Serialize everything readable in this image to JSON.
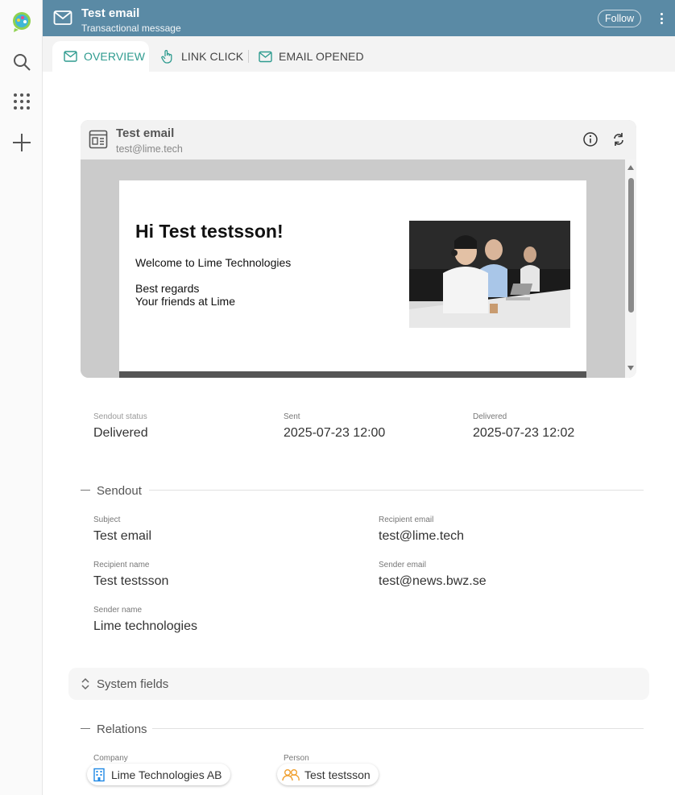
{
  "header": {
    "title": "Test email",
    "subtitle": "Transactional message",
    "follow_label": "Follow"
  },
  "tabs": [
    {
      "label": "OVERVIEW",
      "icon": "envelope-icon",
      "active": true
    },
    {
      "label": "LINK CLICK",
      "icon": "pointer-hand-icon",
      "active": false
    },
    {
      "label": "EMAIL OPENED",
      "icon": "envelope-open-icon",
      "active": false
    }
  ],
  "email_card": {
    "title": "Test email",
    "address": "test@lime.tech",
    "preview": {
      "heading": "Hi Test testsson!",
      "welcome": "Welcome to Lime Technologies",
      "regards": "Best regards",
      "signature": "Your friends at Lime"
    }
  },
  "status": {
    "sendout_status_label": "Sendout status",
    "sendout_status": "Delivered",
    "sent_label": "Sent",
    "sent": "2025-07-23 12:00",
    "delivered_label": "Delivered",
    "delivered": "2025-07-23 12:02"
  },
  "sendout": {
    "title": "Sendout",
    "subject_label": "Subject",
    "subject": "Test email",
    "recipient_email_label": "Recipient email",
    "recipient_email": "test@lime.tech",
    "recipient_name_label": "Recipient name",
    "recipient_name": "Test testsson",
    "sender_email_label": "Sender email",
    "sender_email": "test@news.bwz.se",
    "sender_name_label": "Sender name",
    "sender_name": "Lime technologies"
  },
  "system_fields": {
    "label": "System fields"
  },
  "relations": {
    "title": "Relations",
    "company_label": "Company",
    "company": "Lime Technologies AB",
    "person_label": "Person",
    "person": "Test testsson"
  },
  "colors": {
    "header": "#5a8aa5",
    "accent": "#2e9b8f",
    "company_icon": "#1e88e5",
    "person_icon": "#f0a030"
  }
}
